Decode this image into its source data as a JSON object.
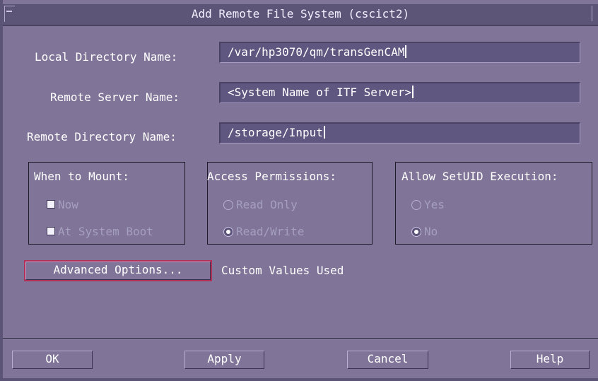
{
  "window": {
    "title": "Add Remote File System (cscict2)"
  },
  "fields": {
    "local_directory": {
      "label": "Local Directory Name:",
      "value": "/var/hp3070/qm/transGenCAM"
    },
    "remote_server": {
      "label": "Remote Server Name:",
      "value": "<System Name of ITF Server>"
    },
    "remote_directory": {
      "label": "Remote Directory Name:",
      "value": "/storage/Input"
    }
  },
  "when_to_mount": {
    "title": "When to Mount:",
    "options": [
      {
        "label": "Now",
        "checked": true
      },
      {
        "label": "At System Boot",
        "checked": true
      }
    ]
  },
  "access_permissions": {
    "title": "Access Permissions:",
    "options": [
      {
        "label": "Read Only",
        "selected": false
      },
      {
        "label": "Read/Write",
        "selected": true
      }
    ]
  },
  "setuid": {
    "title": "Allow SetUID Execution:",
    "options": [
      {
        "label": "Yes",
        "selected": false
      },
      {
        "label": "No",
        "selected": true
      }
    ]
  },
  "advanced": {
    "button_label": "Advanced Options...",
    "status": "Custom Values Used"
  },
  "buttons": {
    "ok": "OK",
    "apply": "Apply",
    "cancel": "Cancel",
    "help": "Help"
  },
  "colors": {
    "background": "#807598",
    "field": "#5f5780",
    "titlebar": "#5d5578",
    "default_highlight": "#b03059",
    "disabled_text": "#a59fbe"
  }
}
